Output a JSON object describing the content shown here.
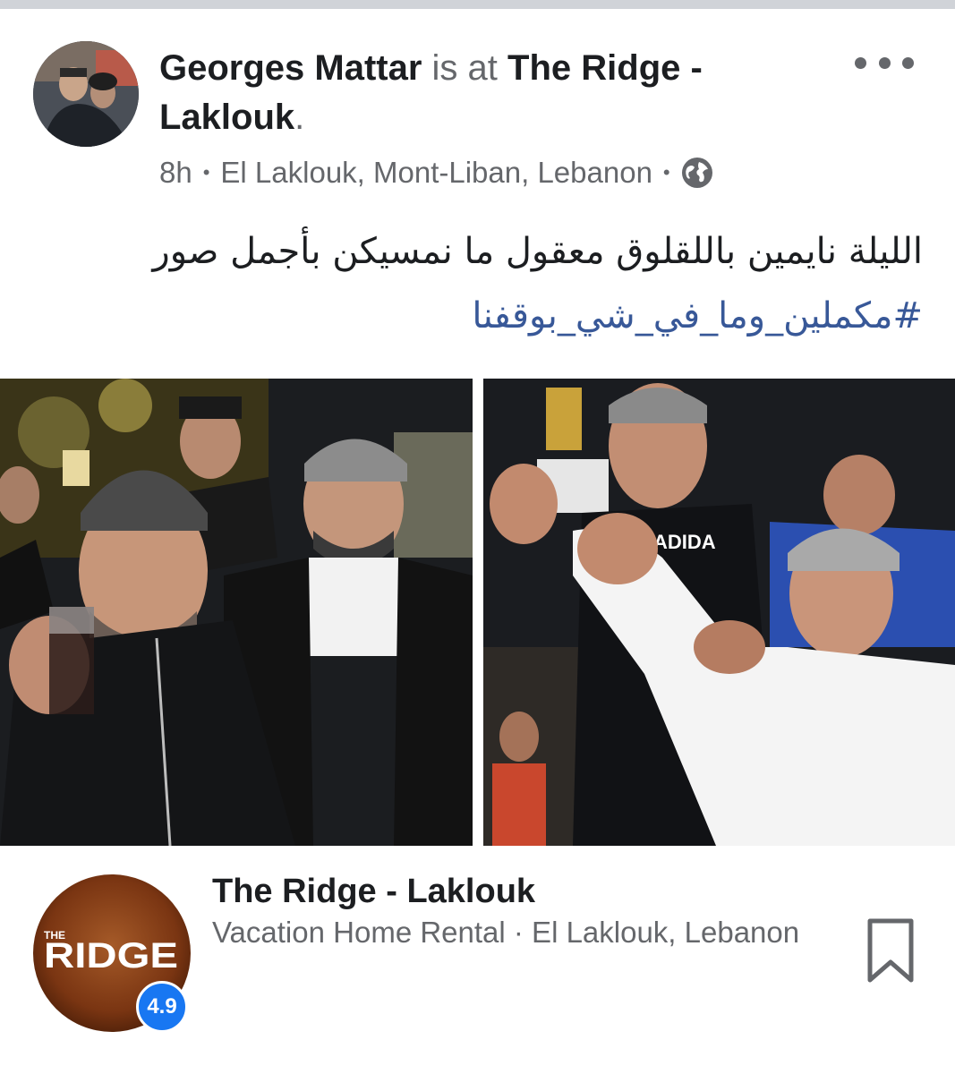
{
  "post": {
    "author": "Georges Mattar",
    "connector": "is at",
    "place_part1": "The Ridge -",
    "place_part2": "Laklouk",
    "period": ".",
    "time": "8h",
    "separator": "•",
    "location": "El Laklouk, Mont-Liban, Lebanon",
    "privacy_icon": "globe-icon",
    "text": "الليلة نايمين باللقلوق معقول ما نمسيكن بأجمل صور",
    "hashtag": "#مكملين_وما_في_شي_بوقفنا"
  },
  "place_card": {
    "logo_text_the": "THE",
    "logo_text_ridge": "RIDGE",
    "rating": "4.9",
    "title": "The Ridge - Laklouk",
    "subtitle": "Vacation Home Rental · El Laklouk, Lebanon",
    "save_icon": "bookmark-icon"
  },
  "colors": {
    "text_primary": "#1c1e21",
    "text_secondary": "#65676b",
    "hashtag": "#385898",
    "rating_badge": "#1877f2"
  }
}
